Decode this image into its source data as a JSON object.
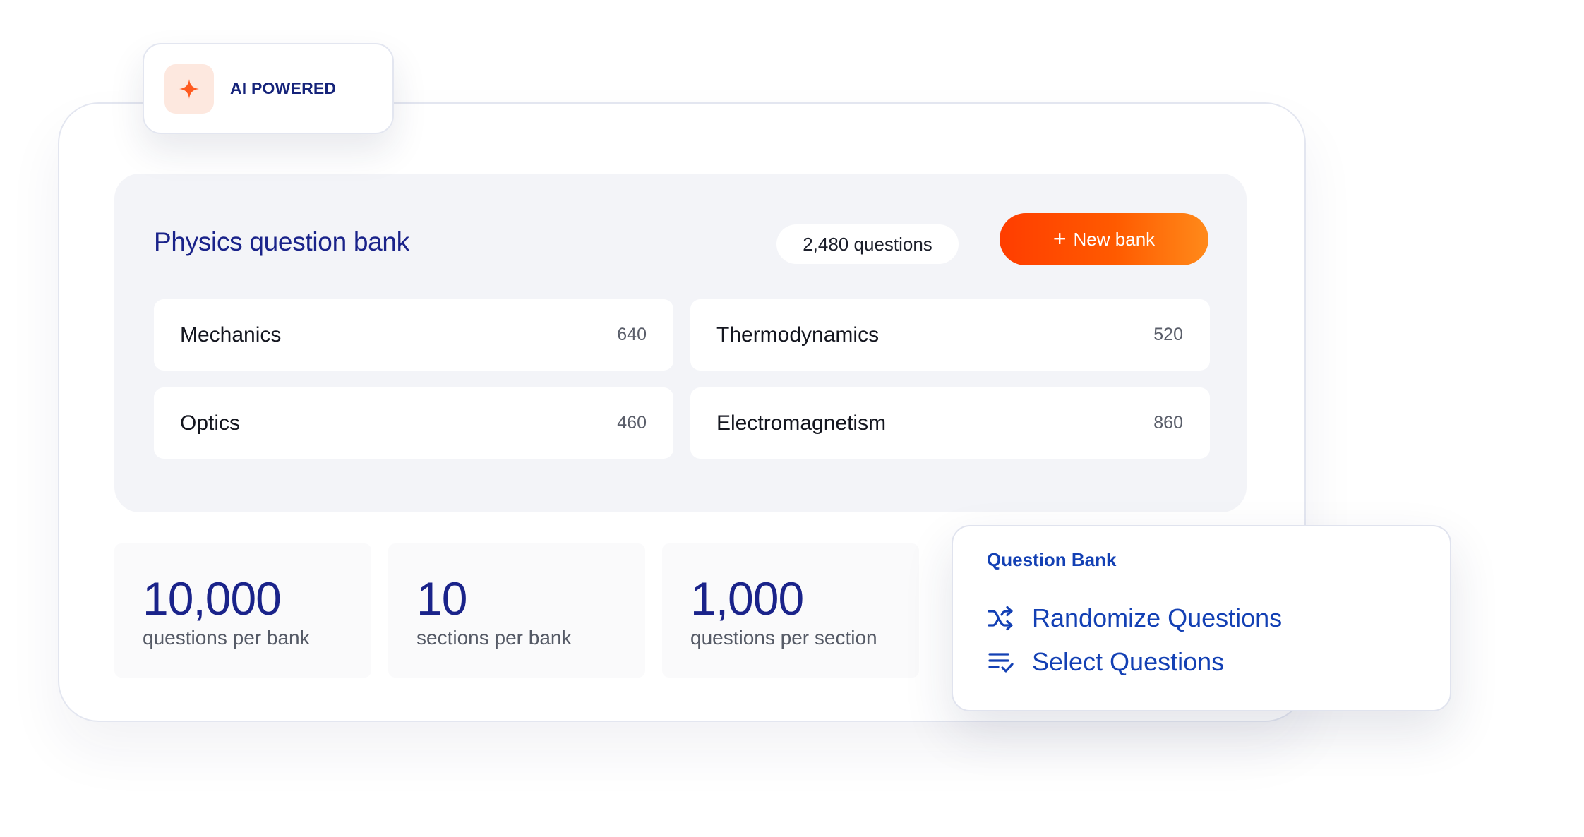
{
  "badge": {
    "label": "AI POWERED",
    "icon": "sparkle-icon",
    "accent": "#ff5a1f"
  },
  "bank": {
    "title": "Physics question bank",
    "count_label": "2,480 questions",
    "new_button": {
      "icon": "+",
      "label": "New bank"
    },
    "sections": [
      {
        "name": "Mechanics",
        "count": "640"
      },
      {
        "name": "Thermodynamics",
        "count": "520"
      },
      {
        "name": "Optics",
        "count": "460"
      },
      {
        "name": "Electromagnetism",
        "count": "860"
      }
    ]
  },
  "stats": [
    {
      "value": "10,000",
      "label": "questions per bank"
    },
    {
      "value": "10",
      "label": "sections per bank"
    },
    {
      "value": "1,000",
      "label": "questions per section"
    }
  ],
  "question_bank_card": {
    "title": "Question Bank",
    "items": [
      {
        "label": "Randomize Questions",
        "icon": "shuffle-icon"
      },
      {
        "label": "Select Questions",
        "icon": "checklist-icon"
      }
    ]
  },
  "colors": {
    "primary_text": "#1a238a",
    "link_blue": "#1340b4",
    "button_gradient_start": "#ff3d00",
    "button_gradient_end": "#ff8a1a"
  }
}
